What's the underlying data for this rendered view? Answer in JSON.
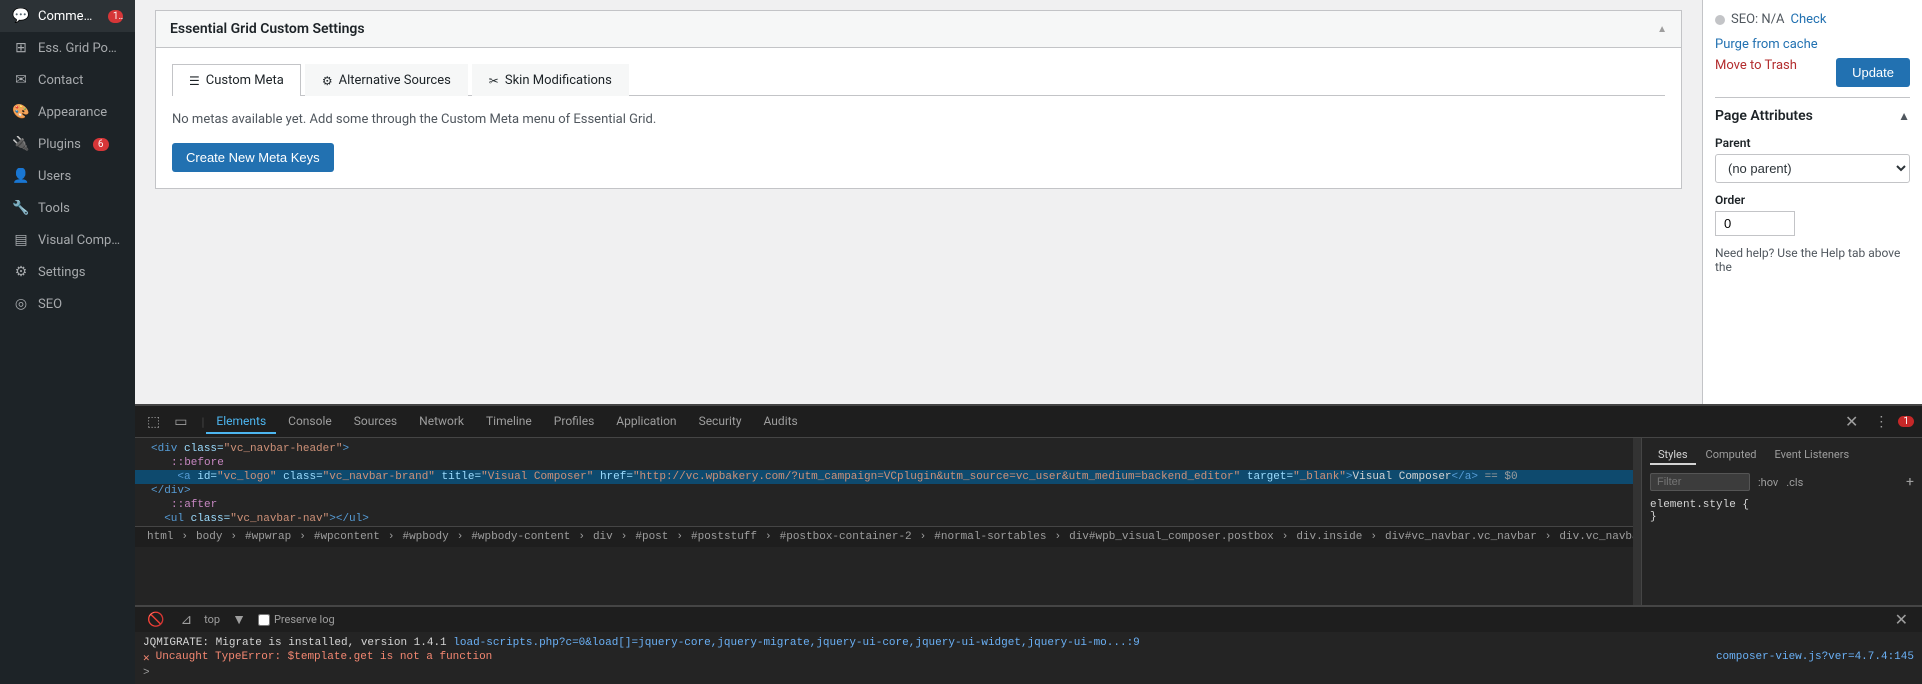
{
  "sidebar": {
    "items": [
      {
        "id": "comments",
        "label": "Comments",
        "icon": "💬",
        "badge": "1",
        "active": false
      },
      {
        "id": "ess-grid-posts",
        "label": "Ess. Grid Posts",
        "icon": "⊞",
        "badge": null,
        "active": false
      },
      {
        "id": "contact",
        "label": "Contact",
        "icon": "✉",
        "badge": null,
        "active": false
      },
      {
        "id": "appearance",
        "label": "Appearance",
        "icon": "🎨",
        "badge": null,
        "active": false
      },
      {
        "id": "plugins",
        "label": "Plugins",
        "icon": "🔌",
        "badge": "6",
        "active": false
      },
      {
        "id": "users",
        "label": "Users",
        "icon": "👤",
        "badge": null,
        "active": false
      },
      {
        "id": "tools",
        "label": "Tools",
        "icon": "🔧",
        "badge": null,
        "active": false
      },
      {
        "id": "visual-composer",
        "label": "Visual Composer",
        "icon": "▤",
        "badge": null,
        "active": false
      },
      {
        "id": "settings",
        "label": "Settings",
        "icon": "⚙",
        "badge": null,
        "active": false
      },
      {
        "id": "seo",
        "label": "SEO",
        "icon": "◎",
        "badge": null,
        "active": false
      }
    ]
  },
  "section_title": "Essential Grid Custom Settings",
  "tabs": [
    {
      "id": "custom-meta",
      "label": "Custom Meta",
      "icon": "☰",
      "active": true
    },
    {
      "id": "alternative-sources",
      "label": "Alternative Sources",
      "icon": "⚙",
      "active": false
    },
    {
      "id": "skin-modifications",
      "label": "Skin Modifications",
      "icon": "✂",
      "active": false
    }
  ],
  "meta_empty_text": "No metas available yet. Add some through the Custom Meta menu of Essential Grid.",
  "create_meta_btn": "Create New Meta Keys",
  "right_sidebar": {
    "seo_label": "SEO: N/A",
    "seo_check": "Check",
    "purge_cache": "Purge from cache",
    "move_trash": "Move to Trash",
    "update_btn": "Update",
    "page_attributes_title": "Page Attributes",
    "parent_label": "Parent",
    "parent_value": "(no parent)",
    "order_label": "Order",
    "order_value": "0",
    "help_text": "Need help? Use the Help tab above the"
  },
  "devtools": {
    "tabs": [
      {
        "id": "elements",
        "label": "Elements",
        "active": true
      },
      {
        "id": "console",
        "label": "Console",
        "active": false
      },
      {
        "id": "sources",
        "label": "Sources",
        "active": false
      },
      {
        "id": "network",
        "label": "Network",
        "active": false
      },
      {
        "id": "timeline",
        "label": "Timeline",
        "active": false
      },
      {
        "id": "profiles",
        "label": "Profiles",
        "active": false
      },
      {
        "id": "application",
        "label": "Application",
        "active": false
      },
      {
        "id": "security",
        "label": "Security",
        "active": false
      },
      {
        "id": "audits",
        "label": "Audits",
        "active": false
      }
    ],
    "dom_lines": [
      {
        "id": 1,
        "html": "&lt;div class=\"vc_navbar-header\"&gt;",
        "indent": 0
      },
      {
        "id": 2,
        "html": "::before",
        "pseudo": true,
        "indent": 1
      },
      {
        "id": 3,
        "html": "&lt;a id=\"vc_logo\" class=\"vc_navbar-brand\" title=\"Visual Composer\" href=\"http://vc.wpbakery.com/?utm_campaign=VCplugin&amp;utm_source=vc_user&amp;utm_medium=backend_editor\" target=\"_blank\"&gt;Visual Composer&lt;/a&gt; == $0",
        "indent": 1,
        "selected": true
      },
      {
        "id": 4,
        "html": "&lt;/div&gt;",
        "indent": 0
      },
      {
        "id": 5,
        "html": "&lt;ul class=\"vc_navbar-nav\"&gt;&lt;/ul&gt;",
        "indent": 0,
        "partial": true
      }
    ],
    "breadcrumb": "html  body  #wpwrap  #wpcontent  #wpbody  #wpbody-content  div  #post  #poststuff  #postbox-container-2  #normal-sortables  div#wpb_visual_composer.postbox  div.inside  div#vc_navbar.vc_navbar  div.vc_navbar-header  a#vc_logo.vc_navbar-brand",
    "styles_tabs": [
      {
        "id": "styles",
        "label": "Styles",
        "active": true
      },
      {
        "id": "computed",
        "label": "Computed",
        "active": false
      },
      {
        "id": "event-listeners",
        "label": "Event Listeners",
        "active": false
      }
    ],
    "styles_filter_placeholder": "Filter",
    "styles_filter_options": [
      ":hov",
      ".cls"
    ],
    "element_style": "element.style {",
    "element_style_close": "}",
    "error_count": "1",
    "console_label": "Console",
    "preserve_log": "Preserve log",
    "console_messages": [
      {
        "type": "info",
        "text": "JQMIGRATE: Migrate is installed, version 1.4.1",
        "link": "load-scripts.php?c=0&load[]=jquery-core,jquery-migrate,jquery-ui-core,jquery-ui-widget,jquery-ui-mo...:9"
      },
      {
        "type": "error",
        "text": "Uncaught TypeError: $template.get is not a function",
        "link": "composer-view.js?ver=4.7.4:145"
      }
    ],
    "console_cursor": ">"
  }
}
